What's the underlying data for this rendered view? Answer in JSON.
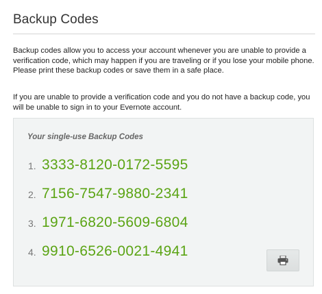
{
  "page": {
    "title": "Backup Codes",
    "paragraph_1": "Backup codes allow you to access your account whenever you are unable to provide a verification code, which may happen if you are traveling or if you lose your mobile phone. Please print these backup codes or save them in a safe place.",
    "paragraph_2": "If you are unable to provide a verification code and you do not have a backup code, you will be unable to sign in to your Evernote account."
  },
  "codes_box": {
    "heading": "Your single-use Backup Codes",
    "codes": [
      {
        "number": "1.",
        "code": "3333-8120-0172-5595"
      },
      {
        "number": "2.",
        "code": "7156-7547-9880-2341"
      },
      {
        "number": "3.",
        "code": "1971-6820-5609-6804"
      },
      {
        "number": "4.",
        "code": "9910-6526-0021-4941"
      }
    ],
    "print_button_icon": "printer-icon"
  },
  "colors": {
    "code_green": "#5ba414",
    "box_background": "#f2f4f4",
    "heading_gray": "#666666"
  }
}
